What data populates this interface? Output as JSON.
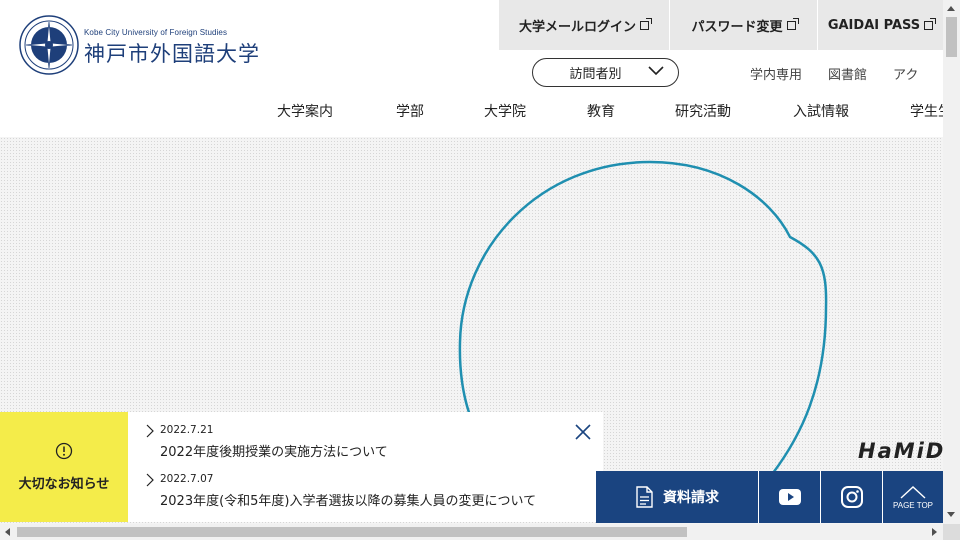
{
  "logo": {
    "en": "Kobe City University of Foreign Studies",
    "ja": "神戸市外国語大学",
    "seal_text": "Kobe City University"
  },
  "topbar": [
    {
      "label": "大学メールログイン"
    },
    {
      "label": "パスワード変更"
    },
    {
      "label": "GAIDAI PASS"
    }
  ],
  "visitor": {
    "label": "訪問者別"
  },
  "sublinks": [
    "学内専用",
    "図書館",
    "アク"
  ],
  "gnav": [
    "大学案内",
    "学部",
    "大学院",
    "教育",
    "研究活動",
    "入試情報",
    "学生生"
  ],
  "hero": {
    "caption": "HaMiDe"
  },
  "notice": {
    "label": "大切なお知らせ",
    "items": [
      {
        "date": "2022.7.21",
        "title": "2022年度後期授業の実施方法について"
      },
      {
        "date": "2022.7.07",
        "title": "2023年度(令和5年度)入学者選抜以降の募集人員の変更について"
      }
    ]
  },
  "bottombar": {
    "document_request": "資料請求",
    "page_top": "PAGE TOP"
  },
  "colors": {
    "navy": "#1a4480",
    "notice_yellow": "#f4ec4a",
    "hero_line": "#1f8fb0"
  }
}
